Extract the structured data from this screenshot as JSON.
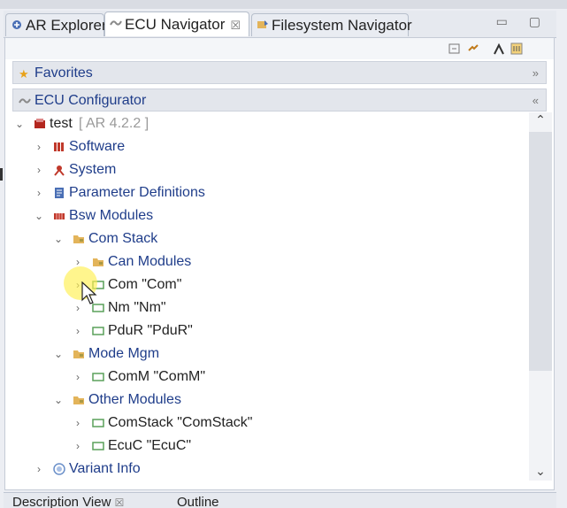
{
  "tabs": [
    {
      "label": "AR Explorer",
      "icon": "explorer-icon"
    },
    {
      "label": "ECU Navigator",
      "icon": "navigator-icon",
      "active": true,
      "close": "☒"
    },
    {
      "label": "Filesystem Navigator",
      "icon": "filesystem-icon"
    }
  ],
  "sections": {
    "favorites": {
      "label": "Favorites",
      "chevron": "»"
    },
    "ecu": {
      "label": "ECU Configurator",
      "chevron": "«"
    }
  },
  "tree": [
    {
      "label": "test",
      "extra": " [ AR 4.2.2 ]",
      "icon": "project-icon"
    },
    {
      "label": "Software",
      "icon": "software-icon"
    },
    {
      "label": "System",
      "icon": "system-icon"
    },
    {
      "label": "Parameter Definitions",
      "icon": "param-defs-icon"
    },
    {
      "label": "Bsw Modules",
      "icon": "bsw-modules-icon"
    },
    {
      "label": "Com Stack",
      "icon": "folder-icon"
    },
    {
      "label": "Can Modules",
      "icon": "folder-icon"
    },
    {
      "label": "Com \"Com\"",
      "icon": "module-icon"
    },
    {
      "label": "Nm \"Nm\"",
      "icon": "module-icon"
    },
    {
      "label": "PduR \"PduR\"",
      "icon": "module-icon"
    },
    {
      "label": "Mode Mgm",
      "icon": "folder-icon"
    },
    {
      "label": "ComM \"ComM\"",
      "icon": "module-icon"
    },
    {
      "label": "Other Modules",
      "icon": "folder-icon"
    },
    {
      "label": "ComStack \"ComStack\"",
      "icon": "module-icon"
    },
    {
      "label": "EcuC \"EcuC\"",
      "icon": "module-icon"
    },
    {
      "label": "Variant Info",
      "icon": "variant-icon"
    }
  ],
  "bottom_tabs": [
    {
      "label": "Description View",
      "close": "☒"
    },
    {
      "label": "Outline"
    }
  ],
  "colors": {
    "folder_text": "#1f3d8a",
    "version_text": "#9a9a9a",
    "module_icon": "#5aa05a",
    "folder_icon": "#e3b45a"
  }
}
